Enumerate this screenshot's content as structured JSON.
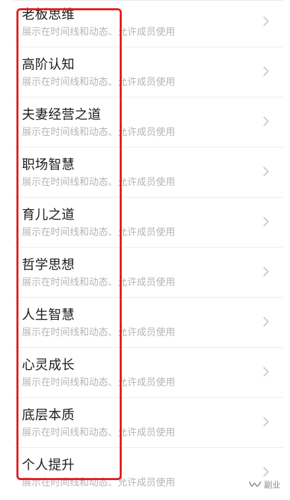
{
  "list": {
    "items": [
      {
        "title": "老板思维",
        "subtitle": "展示在时间线和动态、允许成员使用"
      },
      {
        "title": "高阶认知",
        "subtitle": "展示在时间线和动态、允许成员使用"
      },
      {
        "title": "夫妻经营之道",
        "subtitle": "展示在时间线和动态、允许成员使用"
      },
      {
        "title": "职场智慧",
        "subtitle": "展示在时间线和动态、允许成员使用"
      },
      {
        "title": "育儿之道",
        "subtitle": "展示在时间线和动态、允许成员使用"
      },
      {
        "title": "哲学思想",
        "subtitle": "展示在时间线和动态、允许成员使用"
      },
      {
        "title": "人生智慧",
        "subtitle": "展示在时间线和动态、允许成员使用"
      },
      {
        "title": "心灵成长",
        "subtitle": "展示在时间线和动态、允许成员使用"
      },
      {
        "title": "底层本质",
        "subtitle": "展示在时间线和动态、允许成员使用"
      },
      {
        "title": "个人提升",
        "subtitle": "展示在时间线和动态、允许成员使用"
      }
    ],
    "chevron_icon": "chevron-right-icon",
    "chevron_color": "#c8c8c8"
  },
  "annotation": {
    "highlight_color": "#e02020"
  },
  "watermark": {
    "icon": "wechat-channel-icon",
    "text": "副业"
  }
}
